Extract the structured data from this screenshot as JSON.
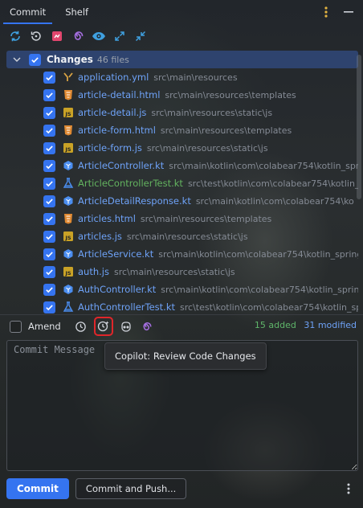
{
  "tabs": [
    {
      "label": "Commit",
      "active": true
    },
    {
      "label": "Shelf",
      "active": false
    }
  ],
  "toolbar_icons": [
    "refresh-icon",
    "rollback-icon",
    "shelve-icon",
    "swirl-icon",
    "eye-icon",
    "expand-icon",
    "collapse-icon"
  ],
  "changes": {
    "title": "Changes",
    "count": "46 files",
    "files": [
      {
        "name": "application.yml",
        "path": "src\\main\\resources",
        "type": "yml",
        "status": "modified"
      },
      {
        "name": "article-detail.html",
        "path": "src\\main\\resources\\templates",
        "type": "html",
        "status": "modified"
      },
      {
        "name": "article-detail.js",
        "path": "src\\main\\resources\\static\\js",
        "type": "js",
        "status": "modified"
      },
      {
        "name": "article-form.html",
        "path": "src\\main\\resources\\templates",
        "type": "html",
        "status": "modified"
      },
      {
        "name": "article-form.js",
        "path": "src\\main\\resources\\static\\js",
        "type": "js",
        "status": "modified"
      },
      {
        "name": "ArticleController.kt",
        "path": "src\\main\\kotlin\\com\\colabear754\\kotlin_sprin",
        "type": "kt",
        "status": "modified"
      },
      {
        "name": "ArticleControllerTest.kt",
        "path": "src\\test\\kotlin\\com\\colabear754\\kotlin_sp",
        "type": "kttest",
        "status": "added"
      },
      {
        "name": "ArticleDetailResponse.kt",
        "path": "src\\main\\kotlin\\com\\colabear754\\ko",
        "type": "kt",
        "status": "modified"
      },
      {
        "name": "articles.html",
        "path": "src\\main\\resources\\templates",
        "type": "html",
        "status": "modified"
      },
      {
        "name": "articles.js",
        "path": "src\\main\\resources\\static\\js",
        "type": "js",
        "status": "modified"
      },
      {
        "name": "ArticleService.kt",
        "path": "src\\main\\kotlin\\com\\colabear754\\kotlin_springb",
        "type": "kt",
        "status": "modified"
      },
      {
        "name": "auth.js",
        "path": "src\\main\\resources\\static\\js",
        "type": "js",
        "status": "modified"
      },
      {
        "name": "AuthController.kt",
        "path": "src\\main\\kotlin\\com\\colabear754\\kotlin_spring",
        "type": "kt",
        "status": "modified"
      },
      {
        "name": "AuthControllerTest.kt",
        "path": "src\\test\\kotlin\\com\\colabear754\\kotlin_spr",
        "type": "kttest",
        "status": "modified"
      }
    ]
  },
  "options": {
    "amend_label": "Amend",
    "added": "15 added",
    "modified": "31 modified"
  },
  "commit_message": {
    "placeholder": "Commit Message"
  },
  "tooltip": "Copilot: Review Code Changes",
  "buttons": {
    "commit": "Commit",
    "commit_and_push": "Commit and Push..."
  },
  "colors": {
    "accent": "#3574f0",
    "added": "#5fb66a",
    "modified": "#6ea2f7",
    "highlight": "#e0262a"
  }
}
